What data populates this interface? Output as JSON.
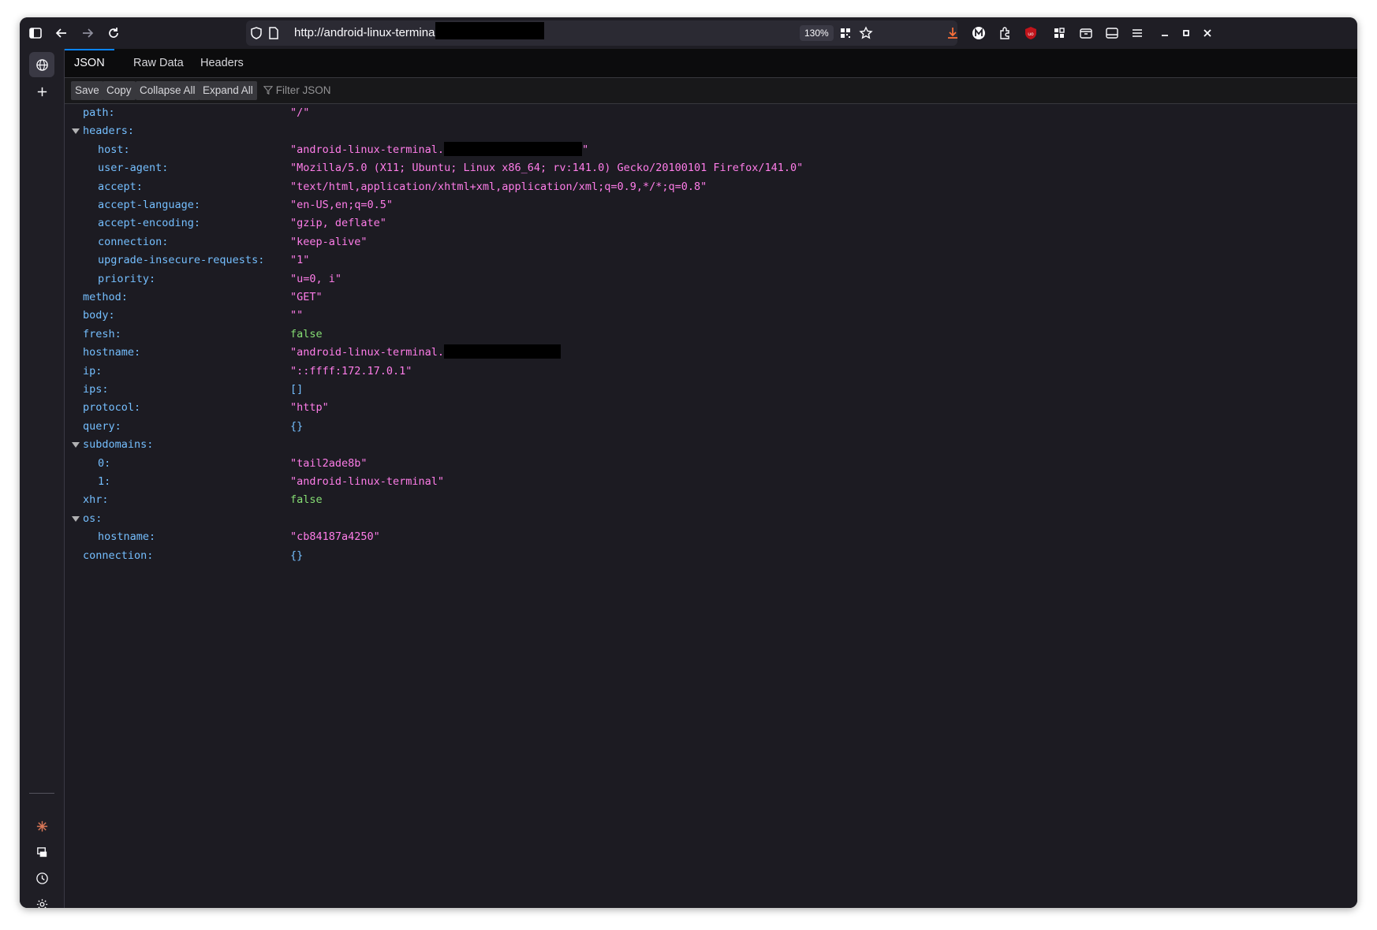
{
  "browser": {
    "url": "http://android-linux-terminal.ta",
    "zoom": "130%"
  },
  "tabs": [
    "JSON",
    "Raw Data",
    "Headers"
  ],
  "toolbar": {
    "save": "Save",
    "copy": "Copy",
    "collapse": "Collapse All",
    "expand": "Expand All",
    "filter_placeholder": "Filter JSON"
  },
  "json_rows": [
    {
      "key": "path:",
      "value": "\"/\"",
      "type": "str",
      "indent": 0
    },
    {
      "key": "headers:",
      "value": "",
      "type": "obj",
      "indent": 0,
      "expanded": true
    },
    {
      "key": "host:",
      "value": "\"android-linux-terminal.",
      "suffix": "\"",
      "type": "str",
      "indent": 1,
      "redacted": true
    },
    {
      "key": "user-agent:",
      "value": "\"Mozilla/5.0 (X11; Ubuntu; Linux x86_64; rv:141.0) Gecko/20100101 Firefox/141.0\"",
      "type": "str",
      "indent": 1
    },
    {
      "key": "accept:",
      "value": "\"text/html,application/xhtml+xml,application/xml;q=0.9,*/*;q=0.8\"",
      "type": "str",
      "indent": 1
    },
    {
      "key": "accept-language:",
      "value": "\"en-US,en;q=0.5\"",
      "type": "str",
      "indent": 1
    },
    {
      "key": "accept-encoding:",
      "value": "\"gzip, deflate\"",
      "type": "str",
      "indent": 1
    },
    {
      "key": "connection:",
      "value": "\"keep-alive\"",
      "type": "str",
      "indent": 1
    },
    {
      "key": "upgrade-insecure-requests:",
      "value": "\"1\"",
      "type": "str",
      "indent": 1
    },
    {
      "key": "priority:",
      "value": "\"u=0, i\"",
      "type": "str",
      "indent": 1
    },
    {
      "key": "method:",
      "value": "\"GET\"",
      "type": "str",
      "indent": 0
    },
    {
      "key": "body:",
      "value": "\"\"",
      "type": "str",
      "indent": 0
    },
    {
      "key": "fresh:",
      "value": "false",
      "type": "bool",
      "indent": 0
    },
    {
      "key": "hostname:",
      "value": "\"android-linux-terminal.",
      "type": "str",
      "indent": 0,
      "redacted": true
    },
    {
      "key": "ip:",
      "value": "\"::ffff:172.17.0.1\"",
      "type": "str",
      "indent": 0
    },
    {
      "key": "ips:",
      "value": "[]",
      "type": "obj",
      "indent": 0
    },
    {
      "key": "protocol:",
      "value": "\"http\"",
      "type": "str",
      "indent": 0
    },
    {
      "key": "query:",
      "value": "{}",
      "type": "obj",
      "indent": 0
    },
    {
      "key": "subdomains:",
      "value": "",
      "type": "obj",
      "indent": 0,
      "expanded": true
    },
    {
      "key": "0:",
      "value": "\"tail2ade8b\"",
      "type": "str",
      "indent": 1
    },
    {
      "key": "1:",
      "value": "\"android-linux-terminal\"",
      "type": "str",
      "indent": 1
    },
    {
      "key": "xhr:",
      "value": "false",
      "type": "bool",
      "indent": 0
    },
    {
      "key": "os:",
      "value": "",
      "type": "obj",
      "indent": 0,
      "expanded": true
    },
    {
      "key": "hostname:",
      "value": "\"cb84187a4250\"",
      "type": "str",
      "indent": 1
    },
    {
      "key": "connection:",
      "value": "{}",
      "type": "obj",
      "indent": 0
    }
  ]
}
